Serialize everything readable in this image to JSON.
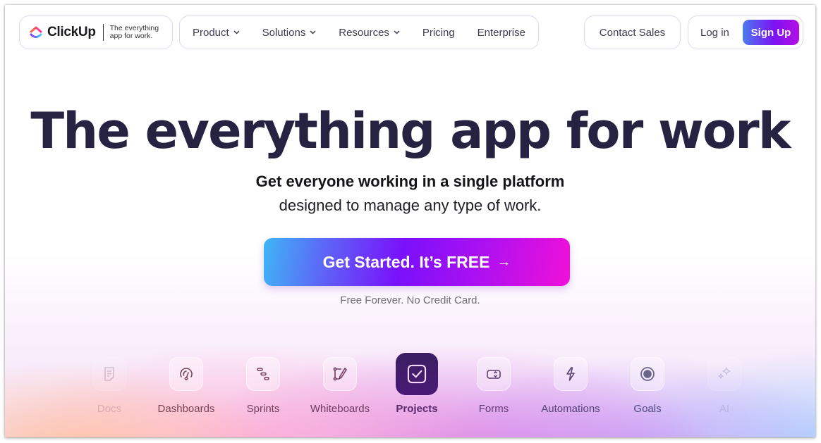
{
  "nav": {
    "logo": {
      "name": "ClickUp",
      "tagline_line1": "The everything",
      "tagline_line2": "app for work."
    },
    "items": [
      {
        "label": "Product",
        "has_dropdown": true
      },
      {
        "label": "Solutions",
        "has_dropdown": true
      },
      {
        "label": "Resources",
        "has_dropdown": true
      },
      {
        "label": "Pricing",
        "has_dropdown": false
      },
      {
        "label": "Enterprise",
        "has_dropdown": false
      }
    ],
    "contact_sales": "Contact Sales",
    "login": "Log in",
    "signup": "Sign Up"
  },
  "hero": {
    "headline": "The everything app for work",
    "subheading_line1": "Get everyone working in a single platform",
    "subheading_line2": "designed to manage any type of work.",
    "cta_label": "Get Started. It’s FREE",
    "cta_arrow": "→",
    "cta_note": "Free Forever. No Credit Card."
  },
  "features": [
    {
      "label": "Docs",
      "icon": "doc-icon",
      "active": false
    },
    {
      "label": "Dashboards",
      "icon": "gauge-icon",
      "active": false
    },
    {
      "label": "Sprints",
      "icon": "sprints-icon",
      "active": false
    },
    {
      "label": "Whiteboards",
      "icon": "whiteboard-icon",
      "active": false
    },
    {
      "label": "Projects",
      "icon": "checkbox-icon",
      "active": true
    },
    {
      "label": "Forms",
      "icon": "form-icon",
      "active": false
    },
    {
      "label": "Automations",
      "icon": "lightning-icon",
      "active": false
    },
    {
      "label": "Goals",
      "icon": "target-icon",
      "active": false
    },
    {
      "label": "AI",
      "icon": "sparkles-icon",
      "active": false
    }
  ],
  "colors": {
    "headline": "#262241",
    "signup_gradient": [
      "#4a7cf0",
      "#7b12f2",
      "#b40fe6"
    ],
    "cta_gradient": [
      "#3fb6f6",
      "#7a10fb",
      "#f010d8"
    ],
    "active_tile": "#3a1e62"
  }
}
